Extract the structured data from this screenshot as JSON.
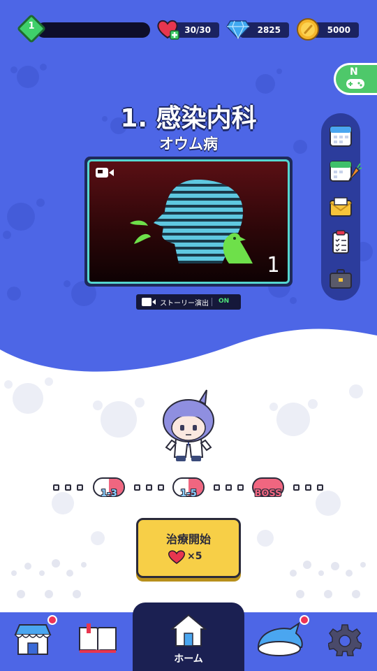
{
  "status": {
    "level": "1",
    "hearts": "30/30",
    "gems": "2825",
    "coins": "5000"
  },
  "side_button": {
    "label": "N"
  },
  "side_menu": [
    "calendar-icon",
    "calendar-carrot-icon",
    "mail-icon",
    "clipboard-icon",
    "briefcase-icon"
  ],
  "chapter": {
    "title": "1. 感染内科",
    "subtitle": "オウム病"
  },
  "video": {
    "number": "1"
  },
  "story_toggle": {
    "label": "ストーリー演出",
    "value": "ON"
  },
  "progress": {
    "stages": [
      "1-3",
      "1-5",
      "BOSS"
    ]
  },
  "start_button": {
    "label": "治療開始",
    "cost": "×5"
  },
  "nav": {
    "home_label": "ホーム"
  },
  "colors": {
    "sky": "#4d66e6",
    "panel": "#1b2360",
    "accent_yellow": "#f7cf47",
    "pill_pink": "#f06680",
    "green": "#4ec86a"
  }
}
